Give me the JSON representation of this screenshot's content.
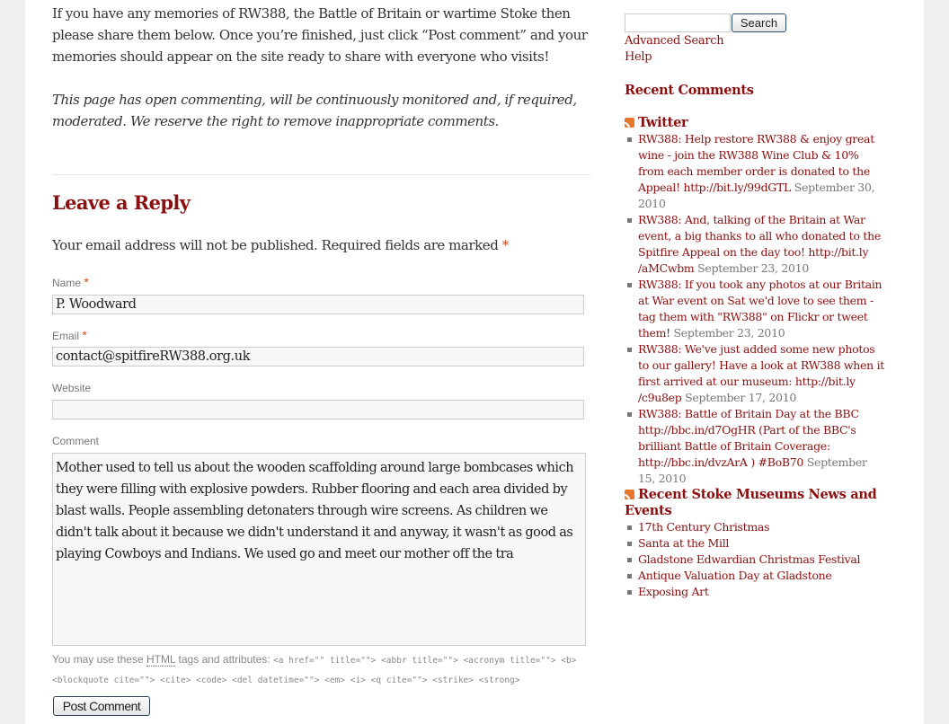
{
  "intro": {
    "paragraph": "If you have any memories of RW388, the Battle of Britain or wartime Stoke then please share them below. Once you’re finished, just click “Post comment” and your memories should appear on the site ready to share with everyone who visits!",
    "moderation_note": "This page has open commenting, will be continuously monitored and, if required, moderated.  We reserve the right to remove inappropriate comments."
  },
  "reply": {
    "title": "Leave a Reply",
    "notes": "Your email address will not be published. Required fields are marked",
    "required_mark": "*",
    "fields": {
      "name": {
        "label": "Name",
        "value": "P. Woodward",
        "required": true
      },
      "email": {
        "label": "Email",
        "value": "contact@spitfireRW388.org.uk",
        "required": true
      },
      "website": {
        "label": "Website",
        "value": "",
        "required": false
      },
      "comment": {
        "label": "Comment",
        "value": "Mother used to tell us about the wooden scaffolding around large bombcases which they were filling with explosive powders. Rubber flooring and each area divided by blast walls. People assembling detonaters through wire screens. As children we didn't talk about it because we didn't understand it and anyway, it wasn't as good as playing Cowboys and Indians. We used go and meet our mother off the tra"
      }
    },
    "allowed_tags_prefix": "You may use these",
    "allowed_tags_abbr": "HTML",
    "allowed_tags_suffix": "tags and attributes:",
    "allowed_tags_code": "<a href=\"\" title=\"\"> <abbr title=\"\"> <acronym title=\"\"> <b> <blockquote cite=\"\"> <cite> <code> <del datetime=\"\"> <em> <i> <q cite=\"\"> <strike> <strong>",
    "submit_label": "Post Comment"
  },
  "sidebar": {
    "search": {
      "value": "",
      "button_label": "Search"
    },
    "links": [
      "Advanced Search",
      "Help"
    ],
    "recent_comments_title": "Recent Comments",
    "twitter": {
      "title": "Twitter",
      "icon": "rss-icon",
      "items": [
        {
          "text": "RW388: Help restore RW388 & enjoy great wine - join the RW388 Wine Club & 10% from each member order is donated to the Appeal! http://bit.ly/99dGTL",
          "date": "September 30, 2010"
        },
        {
          "text": "RW388: And, talking of the Britain at War event, a big thanks to all who donated to the Spitfire Appeal on the day too! http://bit.ly /aMCwbm",
          "date": "September 23, 2010"
        },
        {
          "text": "RW388: If you took any photos at our Britain at War event on Sat we'd love to see them - tag them with \"RW388\" on Flickr or tweet them!",
          "date": "September 23, 2010"
        },
        {
          "text": "RW388: We've just added some new photos to our gallery! Have a look at RW388 when it first arrived at our museum: http://bit.ly /c9u8ep",
          "date": "September 17, 2010"
        },
        {
          "text": "RW388: Battle of Britain Day at the BBC http://bbc.in/d7OgHR (Part of the BBC's brilliant Battle of Britain Coverage: http://bbc.in/dvzArA ) #BoB70",
          "date": "September 15, 2010"
        }
      ]
    },
    "news": {
      "title": "Recent Stoke Museums News and Events",
      "icon": "rss-icon",
      "items": [
        "17th Century Christmas",
        "Santa at the Mill",
        "Gladstone Edwardian Christmas Festival",
        "Antique Valuation Day at Gladstone",
        "Exposing Art"
      ]
    }
  }
}
